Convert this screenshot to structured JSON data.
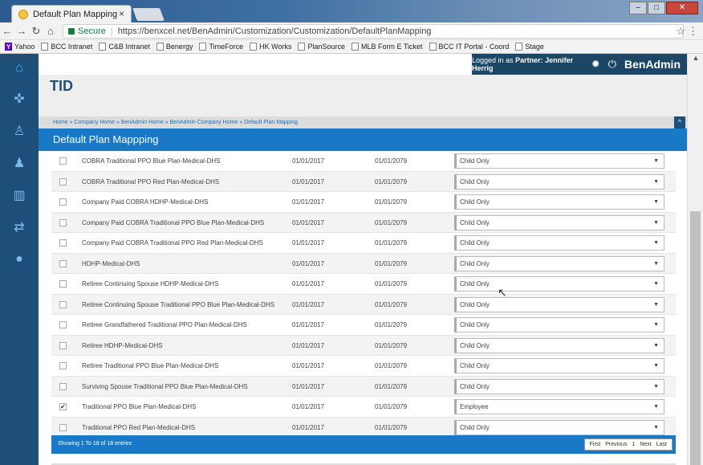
{
  "browser": {
    "tab_title": "Default Plan Mapping",
    "tab_close": "×",
    "url_secure": "Secure",
    "url": "https://benxcel.net/BenAdmin/Customization/Customization/DefaultPlanMapping",
    "bookmarks": [
      "Yahoo",
      "BCC Intranet",
      "C&B Intranet",
      "Benergy",
      "TimeForce",
      "HK Works",
      "PlanSource",
      "MLB Form E Ticket",
      "BCC IT Portal - Coord",
      "Stage"
    ]
  },
  "topbar": {
    "login_prefix": "Logged in as",
    "login_user": "Partner: Jennifer Herrig",
    "brand": "BenAdmin"
  },
  "header": {
    "logo": "TID"
  },
  "breadcrumb": "Home » Company Home » BenAdmin Home » BenAdmin Company Home » Default Plan Mapping",
  "page_title": "Default Plan Mappping",
  "rows": [
    {
      "plan": "COBRA Traditional PPO Blue Plan-Medical-DHS",
      "start": "01/01/2017",
      "end": "01/01/2079",
      "value": "Child Only",
      "checked": ""
    },
    {
      "plan": "COBRA Traditional PPO Red Plan-Medical-DHS",
      "start": "01/01/2017",
      "end": "01/01/2079",
      "value": "Child Only",
      "checked": ""
    },
    {
      "plan": "Company Paid COBRA HDHP-Medical-DHS",
      "start": "01/01/2017",
      "end": "01/01/2079",
      "value": "Child Only",
      "checked": ""
    },
    {
      "plan": "Company Paid COBRA Traditional PPO Blue Plan-Medical-DHS",
      "start": "01/01/2017",
      "end": "01/01/2079",
      "value": "Child Only",
      "checked": ""
    },
    {
      "plan": "Company Paid COBRA Traditional PPO Red Plan-Medical-DHS",
      "start": "01/01/2017",
      "end": "01/01/2079",
      "value": "Child Only",
      "checked": ""
    },
    {
      "plan": "HDHP-Medical-DHS",
      "start": "01/01/2017",
      "end": "01/01/2079",
      "value": "Child Only",
      "checked": ""
    },
    {
      "plan": "Retiree Continuing Spouse HDHP-Medical-DHS",
      "start": "01/01/2017",
      "end": "01/01/2079",
      "value": "Child Only",
      "checked": ""
    },
    {
      "plan": "Retiree Continuing Spouse Traditional PPO Blue Plan-Medical-DHS",
      "start": "01/01/2017",
      "end": "01/01/2079",
      "value": "Child Only",
      "checked": ""
    },
    {
      "plan": "Retiree Grandfathered Traditional PPO Plan-Medical-DHS",
      "start": "01/01/2017",
      "end": "01/01/2079",
      "value": "Child Only",
      "checked": ""
    },
    {
      "plan": "Retiree HDHP-Medical-DHS",
      "start": "01/01/2017",
      "end": "01/01/2079",
      "value": "Child Only",
      "checked": ""
    },
    {
      "plan": "Retiree Traditional PPO Blue Plan-Medical-DHS",
      "start": "01/01/2017",
      "end": "01/01/2079",
      "value": "Child Only",
      "checked": ""
    },
    {
      "plan": "Surviving Spouse Traditional PPO Blue Plan-Medical-DHS",
      "start": "01/01/2017",
      "end": "01/01/2079",
      "value": "Child Only",
      "checked": ""
    },
    {
      "plan": "Traditional PPO Blue Plan-Medical-DHS",
      "start": "01/01/2017",
      "end": "01/01/2079",
      "value": "Employee",
      "checked": "✔"
    },
    {
      "plan": "Traditional PPO Red Plan-Medical-DHS",
      "start": "01/01/2017",
      "end": "01/01/2079",
      "value": "Child Only",
      "checked": ""
    }
  ],
  "footer": {
    "info": "Showing 1 To 18 of 18 entries",
    "first": "First",
    "previous": "Previous",
    "page": "1",
    "next": "Next",
    "last": "Last"
  },
  "icons": {
    "sidebar": [
      "home-icon",
      "puzzle-icon",
      "user-add-icon",
      "user-icon",
      "bar-chart-icon",
      "transfer-icon",
      "chat-icon"
    ]
  }
}
